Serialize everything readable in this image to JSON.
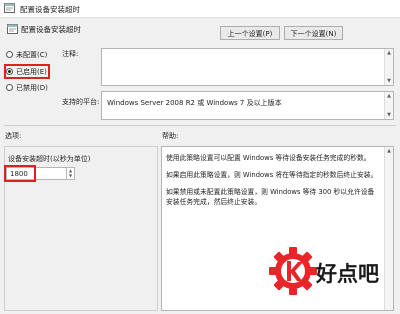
{
  "window": {
    "title": "配置设备安装超时"
  },
  "header": {
    "title": "配置设备安装超时"
  },
  "nav": {
    "prev_label": "上一个设置(P)",
    "next_label": "下一个设置(N)"
  },
  "state": {
    "options": [
      {
        "label": "未配置(C)",
        "checked": false
      },
      {
        "label": "已启用(E)",
        "checked": true
      },
      {
        "label": "已禁用(D)",
        "checked": false
      }
    ]
  },
  "comment": {
    "label": "注释:",
    "value": ""
  },
  "platform": {
    "label": "支持的平台:",
    "value": "Windows Server 2008 R2 或 Windows 7 及以上版本"
  },
  "options_panel": {
    "label": "选项:",
    "timeout_label": "设备安装超时(以秒为单位)",
    "timeout_value": "1800"
  },
  "help_panel": {
    "label": "帮助:",
    "paragraphs": [
      "使用此策略设置可以配置 Windows 等待设备安装任务完成的秒数。",
      "如果启用此策略设置，则 Windows 将在等待指定的秒数后终止安装。",
      "如果禁用或未配置此策略设置，则 Windows 等待 300 秒以允许设备安装任务完成，然后终止安装。"
    ]
  },
  "watermark": {
    "text": "好点吧"
  },
  "colors": {
    "highlight": "#dd2222",
    "logo": "#e8262a"
  }
}
